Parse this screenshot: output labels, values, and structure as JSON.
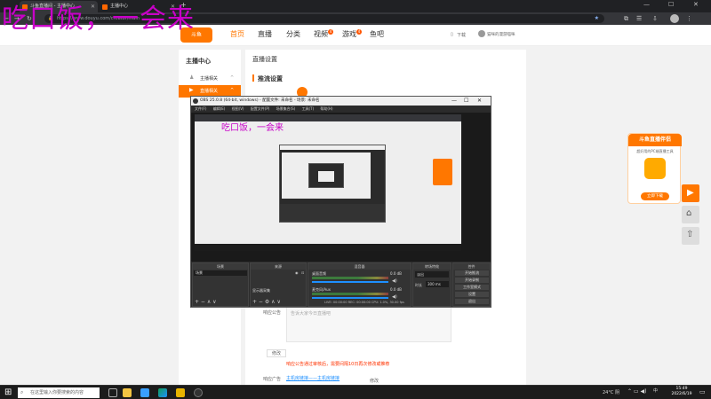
{
  "watermark": "吃口饭，一会来",
  "browser": {
    "tabs": [
      {
        "label": "斗鱼直播间 - 主播中心"
      },
      {
        "label": "主播中心"
      }
    ],
    "url": "https://www.douyu.com/creator/main",
    "download_label": "下载",
    "user_label": "猫咪的漫游喵咪"
  },
  "header": {
    "logo_text": "斗鱼",
    "nav": [
      "首页",
      "直播",
      "分类",
      "视频",
      "游戏",
      "鱼吧"
    ],
    "video_badge": "4",
    "game_badge": "4",
    "download": "下载"
  },
  "sidebar": {
    "title": "主播中心",
    "items": [
      {
        "label": "主播相关"
      },
      {
        "label": "直播相关"
      }
    ]
  },
  "content": {
    "page_title": "直播设置",
    "section_title": "推流设置",
    "form_label_1": "响应公告",
    "textarea_placeholder": "告诉大家今日直播吧",
    "edit_label": "修改",
    "hint_text": "响应公告通过审核后，需要间隔10日再次修改或推荐",
    "form_label_2": "响应广告",
    "link_text": "主机房链接——主机房链接",
    "edit_label_2": "修改"
  },
  "obs": {
    "title": "OBS 25.0.8 (64-bit, windows) - 配置文件: 未命名 - 场景: 未命名",
    "menu": [
      "文件(F)",
      "编辑(E)",
      "视图(V)",
      "配置文件(P)",
      "场景集合(S)",
      "工具(T)",
      "帮助(H)"
    ],
    "docks": {
      "scenes": {
        "title": "场景",
        "items": [
          "场景"
        ]
      },
      "sources": {
        "title": "来源",
        "items": [
          "显示器采集"
        ]
      },
      "mixer": {
        "title": "混音器",
        "channels": [
          {
            "name": "桌面音频",
            "level": "0.0 dB"
          },
          {
            "name": "麦克风/Aux",
            "level": "0.0 dB"
          }
        ]
      },
      "transitions": {
        "title": "转场特效",
        "type": "淡出",
        "duration_label": "时长",
        "duration_value": "300 ms"
      },
      "controls": {
        "title": "控件",
        "buttons": [
          "开始推流",
          "开始录制",
          "工作室模式",
          "设置",
          "退出"
        ]
      }
    },
    "status": "LIVE: 00:00:00   REC: 00:00:00   CPU: 1.0%, 30.00 fps"
  },
  "promo": {
    "title": "斗鱼直播伴侣",
    "subtitle": "超好用的PC端直播工具",
    "button": "立即下载"
  },
  "taskbar": {
    "search_placeholder": "在这里输入你要搜索的内容",
    "weather": "24°C 阴",
    "time": "15:49",
    "date": "2022/6/19"
  },
  "colors": {
    "brand": "#ff7700",
    "obs_bg": "#2b2b2b",
    "taskbar": "#1c1c1c",
    "accent_blue": "#1e90ff"
  }
}
